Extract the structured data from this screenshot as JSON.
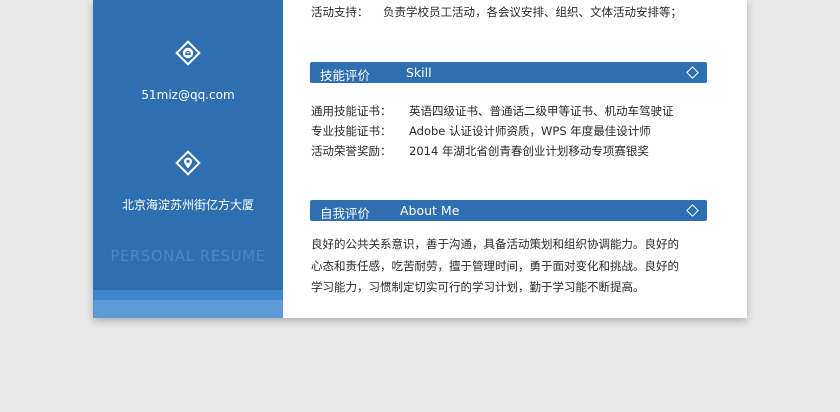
{
  "sidebar": {
    "email": "51miz@qq.com",
    "email_icon": "envelope-icon",
    "address": "北京海淀苏州街亿方大厦",
    "address_icon": "location-pin-icon",
    "watermark": "PERSONAL RESUME"
  },
  "activity": {
    "label": "活动支持：",
    "value": "负责学校员工活动，各会议安排、组织、文体活动安排等；"
  },
  "skill": {
    "title_cn": "技能评价",
    "title_en": "Skill",
    "rows": [
      {
        "label": "通用技能证书：",
        "value": "英语四级证书、普通话二级甲等证书、机动车驾驶证"
      },
      {
        "label": "专业技能证书：",
        "value": "Adobe 认证设计师资质，WPS 年度最佳设计师"
      },
      {
        "label": "活动荣誉奖励：",
        "value": "2014 年湖北省创青春创业计划移动专项赛银奖"
      }
    ]
  },
  "about": {
    "title_cn": "自我评价",
    "title_en": "About Me",
    "lines": [
      "良好的公共关系意识，善于沟通，具备活动策划和组织协调能力。良好的",
      "心态和责任感，吃苦耐劳，擅于管理时间，勇于面对变化和挑战。良好的",
      "学习能力，习惯制定切实可行的学习计划，勤于学习能不断提高。"
    ]
  },
  "colors": {
    "primary": "#2e6fb1",
    "light": "#5d9ad6",
    "background": "#e9e9e9"
  }
}
